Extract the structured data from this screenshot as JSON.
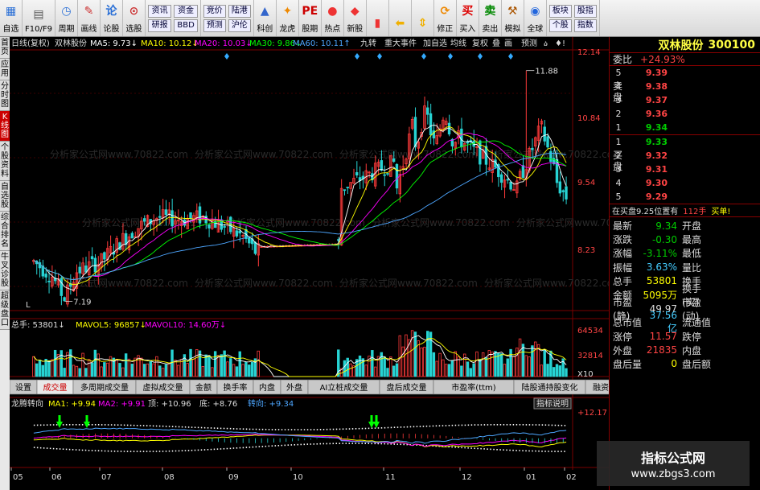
{
  "toolbar": {
    "buttons": [
      {
        "label": "自选",
        "icon": "grid-icon"
      },
      {
        "label": "F10/F9",
        "icon": "book-icon"
      },
      {
        "label": "周期",
        "icon": "clock-icon"
      },
      {
        "label": "画线",
        "icon": "pen-icon"
      },
      {
        "label": "论股",
        "icon": "chat-icon"
      },
      {
        "label": "选股",
        "icon": "chart-search-icon"
      }
    ],
    "grid_a": [
      "资讯",
      "资金",
      "研报",
      "BBD"
    ],
    "grid_b": [
      "竞价",
      "陆港",
      "预测",
      "沪伦"
    ],
    "buttons2": [
      {
        "label": "科创",
        "icon": "rocket-icon"
      },
      {
        "label": "龙虎",
        "icon": "tiger-icon"
      },
      {
        "label": "股期",
        "icon": "pe-icon"
      },
      {
        "label": "热点",
        "icon": "hot-icon"
      },
      {
        "label": "新股",
        "icon": "new-stock-icon"
      }
    ],
    "buttons3": [
      {
        "label": "",
        "icon": "bar-chart-icon"
      },
      {
        "label": "",
        "icon": "back-arrow-icon"
      },
      {
        "label": "",
        "icon": "arrows-icon"
      },
      {
        "label": "修正",
        "icon": "refresh-icon"
      },
      {
        "label": "买入",
        "icon": "buy-icon"
      },
      {
        "label": "卖出",
        "icon": "sell-icon"
      },
      {
        "label": "模拟",
        "icon": "hammer-icon"
      },
      {
        "label": "全球",
        "icon": "globe-icon"
      }
    ],
    "grid_c": [
      "板块",
      "股指",
      "个股",
      "指数"
    ]
  },
  "side_tabs": [
    "首页",
    "应用",
    "分时图",
    "K线图",
    "个股资料",
    "自选股",
    "综合排名",
    "牛叉诊股",
    "超级盘口"
  ],
  "chart_header": {
    "period": "日线(复权)",
    "name": "双林股份",
    "ma5": "MA5: 9.73↓",
    "ma10": "MA10: 10.12↓",
    "ma20": "MA20: 10.03↓",
    "ma30": "MA30: 9.86↓",
    "ma60": "MA60: 10.11↑",
    "buttons": [
      "九转",
      "重大事件",
      "加自选",
      "均线",
      "复权",
      "叠",
      "画",
      "预测",
      "ዕ",
      "♦!"
    ]
  },
  "price_axis": [
    "12.14",
    "10.84",
    "9.54",
    "8.23"
  ],
  "high_label": "11.88",
  "low_label": "7.19",
  "l_marker": "L",
  "volume_header": {
    "total": "总手: 53801↓",
    "mavol5": "MAVOL5: 96857↓",
    "mavol10": "MAVOL10: 14.60万↓"
  },
  "volume_axis": [
    "64534",
    "32814",
    "X10"
  ],
  "indicator_tabs": [
    "设置",
    "成交量",
    "多周期成交量",
    "虚拟成交量",
    "金额",
    "换手率",
    "内盘",
    "外盘",
    "AI立桩成交量",
    "盘后成交量",
    "市盈率(ttm)",
    "陆股通持股变化",
    "融资融券变化"
  ],
  "indicator_header": {
    "name": "龙腾转向",
    "ma1": "MA1: +9.94",
    "ma2": "MA2: +9.91",
    "top": "顶: +10.96",
    "bottom": "底: +8.76",
    "zhuan": "转向: +9.34",
    "help": "指标说明"
  },
  "indicator_axis": "+12.17",
  "date_axis": [
    "05",
    "06",
    "07",
    "08",
    "09",
    "10",
    "11",
    "12",
    "01",
    "02"
  ],
  "watermark_text": "分析家公式网www.70822.com",
  "right_panel": {
    "name": "双林股份",
    "code": "300100",
    "weibi_label": "委比",
    "weibi_value": "+24.93%",
    "sell_label": "卖盘",
    "buy_label": "买盘",
    "asks": [
      {
        "level": "5",
        "price": "9.39"
      },
      {
        "level": "4",
        "price": "9.38"
      },
      {
        "level": "3",
        "price": "9.37"
      },
      {
        "level": "2",
        "price": "9.36"
      },
      {
        "level": "1",
        "price": "9.34"
      }
    ],
    "bids": [
      {
        "level": "1",
        "price": "9.33"
      },
      {
        "level": "2",
        "price": "9.32"
      },
      {
        "level": "3",
        "price": "9.31"
      },
      {
        "level": "4",
        "price": "9.30"
      },
      {
        "level": "5",
        "price": "9.29"
      }
    ],
    "bar_level": 0.6,
    "zaimai_a": "在买盘9.25位置有",
    "zaimai_b": "112手",
    "zaimai_c": "买单!",
    "stats": [
      {
        "k1": "最新",
        "v1": "9.34",
        "c1": "grn",
        "k2": "开盘",
        "v2": "",
        "c2": "wht"
      },
      {
        "k1": "涨跌",
        "v1": "-0.30",
        "c1": "grn",
        "k2": "最高",
        "v2": "",
        "c2": "wht"
      },
      {
        "k1": "涨幅",
        "v1": "-3.11%",
        "c1": "grn",
        "k2": "最低",
        "v2": "",
        "c2": "wht"
      },
      {
        "k1": "振幅",
        "v1": "3.63%",
        "c1": "cya",
        "k2": "量比",
        "v2": "",
        "c2": "wht"
      },
      {
        "k1": "总手",
        "v1": "53801",
        "c1": "yel",
        "k2": "换手",
        "v2": "",
        "c2": "wht"
      },
      {
        "k1": "金额",
        "v1": "5095万",
        "c1": "yel",
        "k2": "换手(实)",
        "v2": "",
        "c2": "wht"
      },
      {
        "k1": "市盈(静)",
        "v1": "49.97",
        "c1": "wht",
        "k2": "市盈(动)",
        "v2": "",
        "c2": "wht"
      },
      {
        "k1": "总市值",
        "v1": "37.56亿",
        "c1": "cya",
        "k2": "流通值",
        "v2": "",
        "c2": "wht"
      },
      {
        "k1": "涨停",
        "v1": "11.57",
        "c1": "red",
        "k2": "跌停",
        "v2": "",
        "c2": "wht"
      },
      {
        "k1": "外盘",
        "v1": "21835",
        "c1": "red",
        "k2": "内盘",
        "v2": "",
        "c2": "wht"
      },
      {
        "k1": "盘后量",
        "v1": "0",
        "c1": "yel",
        "k2": "盘后额",
        "v2": "",
        "c2": "wht"
      }
    ]
  },
  "site_badge": {
    "line1": "指标公式网",
    "line2": "www.zbgs3.com"
  },
  "colors": {
    "up": "#ff3b3b",
    "down": "#27d3d3",
    "ma5": "#ffffff",
    "ma10": "#ffff00",
    "ma20": "#ff00ff",
    "ma30": "#00ff00",
    "ma60": "#4da6ff",
    "grid": "#7a0000"
  }
}
